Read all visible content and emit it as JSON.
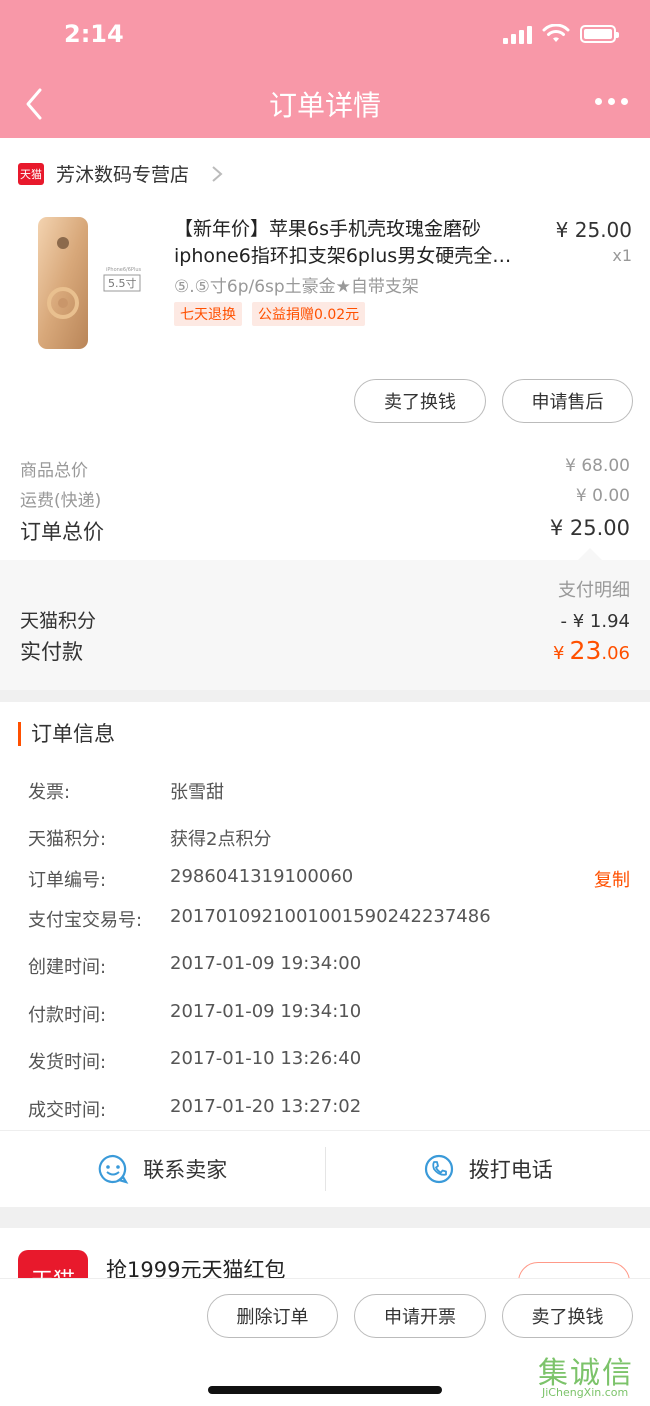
{
  "status_bar": {
    "time": "2:14"
  },
  "header": {
    "title": "订单详情"
  },
  "shop": {
    "badge": "天猫",
    "name": "芳沐数码专营店"
  },
  "product": {
    "title": "【新年价】苹果6s手机壳玫瑰金磨砂iphone6指环扣支架6plus男女硬壳全…",
    "price": "¥ 25.00",
    "qty": "x1",
    "sku": "⑤.⑤寸6p/6sp土豪金★自带支架",
    "image_label": "5.5寸",
    "image_caption": "iPhone6/6Plus",
    "tags": [
      "七天退换",
      "公益捐赠0.02元"
    ]
  },
  "item_actions": {
    "sell": "卖了换钱",
    "aftersale": "申请售后"
  },
  "pricing": {
    "goods_label": "商品总价",
    "goods_value": "¥ 68.00",
    "shipping_label": "运费(快递)",
    "shipping_value": "¥ 0.00",
    "total_label": "订单总价",
    "total_value": "¥ 25.00"
  },
  "payment": {
    "detail_label": "支付明细",
    "points_label": "天猫积分",
    "points_value": "- ¥ 1.94",
    "paid_label": "实付款",
    "paid_currency": "¥",
    "paid_int": "23",
    "paid_dec": ".06"
  },
  "order_info": {
    "title": "订单信息",
    "copy_label": "复制",
    "rows": [
      {
        "label": "发票:",
        "value": "张雪甜"
      },
      {
        "label": "天猫积分:",
        "value": "获得2点积分"
      },
      {
        "label": "订单编号:",
        "value": "2986041319100060"
      },
      {
        "label": "支付宝交易号:",
        "value": "2017010921001001590242237486"
      },
      {
        "label": "创建时间:",
        "value": "2017-01-09 19:34:00"
      },
      {
        "label": "付款时间:",
        "value": "2017-01-09 19:34:10"
      },
      {
        "label": "发货时间:",
        "value": "2017-01-10 13:26:40"
      },
      {
        "label": "成交时间:",
        "value": "2017-01-20 13:27:02"
      }
    ],
    "contact_seller": "联系卖家",
    "call": "拨打电话"
  },
  "promo": {
    "logo": "天猫",
    "text": "抢1999元天猫红包"
  },
  "bottom_actions": {
    "delete": "删除订单",
    "invoice": "申请开票",
    "sell": "卖了换钱"
  },
  "watermark": {
    "text": "集诚信",
    "url": "JiChengXin.com"
  },
  "colors": {
    "header": "#f898a8",
    "accent": "#ff5000",
    "tmall_red": "#e8192c",
    "icon_blue": "#3a9ad9"
  }
}
